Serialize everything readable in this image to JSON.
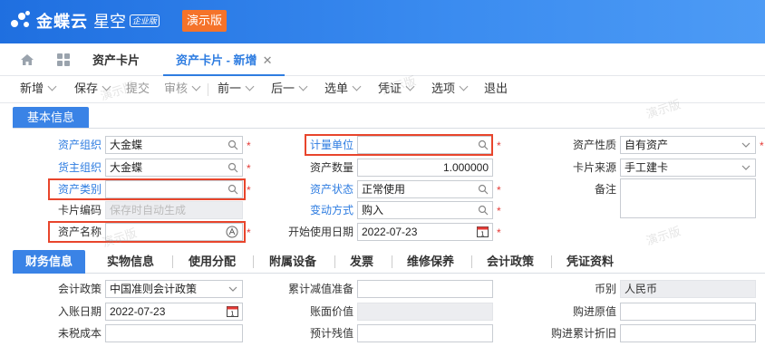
{
  "app": {
    "logo_text": "金蝶云",
    "logo_sub": "星空",
    "edition": "企业版",
    "demo_badge": "演示版"
  },
  "tabs": [
    {
      "label": "资产卡片"
    },
    {
      "label": "资产卡片 - 新增",
      "close": "✕"
    }
  ],
  "toolbar": {
    "items": [
      "新增",
      "保存",
      "提交",
      "审核",
      "前一",
      "后一",
      "选单",
      "凭证",
      "选项",
      "退出"
    ]
  },
  "watermark": "演示版",
  "basic": {
    "section_title": "基本信息",
    "asset_org_label": "资产组织",
    "asset_org_value": "大金蝶",
    "owner_org_label": "货主组织",
    "owner_org_value": "大金蝶",
    "asset_category_label": "资产类别",
    "asset_category_value": "",
    "card_code_label": "卡片编码",
    "card_code_placeholder": "保存时自动生成",
    "asset_name_label": "资产名称",
    "asset_name_value": "",
    "unit_label": "计量单位",
    "unit_value": "",
    "quantity_label": "资产数量",
    "quantity_value": "1.000000",
    "status_label": "资产状态",
    "status_value": "正常使用",
    "change_method_label": "变动方式",
    "change_method_value": "购入",
    "start_date_label": "开始使用日期",
    "start_date_value": "2022-07-23",
    "nature_label": "资产性质",
    "nature_value": "自有资产",
    "source_label": "卡片来源",
    "source_value": "手工建卡",
    "remark_label": "备注",
    "remark_value": "",
    "required_mark": "*"
  },
  "subtabs": [
    "财务信息",
    "实物信息",
    "使用分配",
    "附属设备",
    "发票",
    "维修保养",
    "会计政策",
    "凭证资料"
  ],
  "finance": {
    "policy_label": "会计政策",
    "policy_value": "中国准则会计政策",
    "entry_date_label": "入账日期",
    "entry_date_value": "2022-07-23",
    "pretax_cost_label": "未税成本",
    "pretax_cost_value": "",
    "impairment_label": "累计减值准备",
    "impairment_value": "",
    "book_value_label": "账面价值",
    "book_value_value": "",
    "residual_label": "预计残值",
    "residual_value": "",
    "currency_label": "币别",
    "currency_value": "人民币",
    "purchase_original_label": "购进原值",
    "purchase_original_value": "",
    "purchase_depr_label": "购进累计折旧",
    "purchase_depr_value": ""
  },
  "colors": {
    "brand_blue": "#2f7de1",
    "badge_orange": "#f5732a",
    "highlight_red": "#e8452c"
  }
}
